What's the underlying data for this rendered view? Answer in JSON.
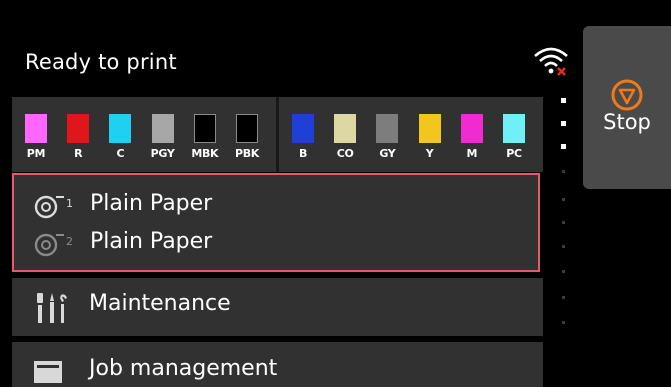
{
  "status": {
    "title": "Ready to print"
  },
  "icons": {
    "wifi": "wifi-error-icon",
    "stop": "stop-icon",
    "roll1": "roll-1-icon",
    "roll2": "roll-2-icon",
    "maintenance": "maintenance-icon",
    "job": "job-management-icon"
  },
  "inks_left": [
    {
      "label": "PM",
      "color": "#ff66ff"
    },
    {
      "label": "R",
      "color": "#e0161b"
    },
    {
      "label": "C",
      "color": "#1fd0f2"
    },
    {
      "label": "PGY",
      "color": "#a7a7a7"
    },
    {
      "label": "MBK",
      "color": "#000000"
    },
    {
      "label": "PBK",
      "color": "#000000"
    }
  ],
  "inks_right": [
    {
      "label": "B",
      "color": "#1f3fd6"
    },
    {
      "label": "CO",
      "color": "#dcd7a3"
    },
    {
      "label": "GY",
      "color": "#7d7d7d"
    },
    {
      "label": "Y",
      "color": "#f2c61c"
    },
    {
      "label": "M",
      "color": "#f02cd0"
    },
    {
      "label": "PC",
      "color": "#6ff0f7"
    }
  ],
  "paper": {
    "roll1": "Plain Paper",
    "roll2": "Plain Paper"
  },
  "menu": {
    "maintenance": "Maintenance",
    "job_management": "Job management"
  },
  "stop_button": {
    "label": "Stop"
  },
  "colors": {
    "selection_border": "#e85a6a",
    "stop_orange": "#f07a1a",
    "panel": "#313131"
  },
  "pager": {
    "total": 10,
    "active": [
      0,
      1,
      2
    ]
  }
}
